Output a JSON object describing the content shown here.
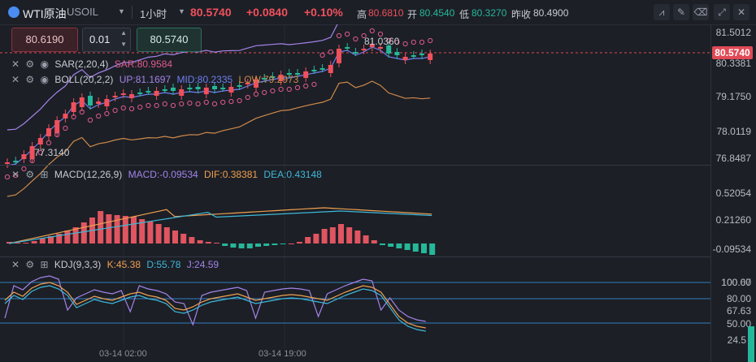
{
  "header": {
    "symbol_icon": "symbol-logo-icon",
    "symbol_name": "WTI原油",
    "symbol_code": "USOIL",
    "interval": "1小时",
    "price": "80.5740",
    "change": "+0.0840",
    "change_pct": "+0.10%",
    "high_label": "高",
    "high": "80.6810",
    "open_label": "开",
    "open": "80.4540",
    "low_label": "低",
    "low": "80.3270",
    "prev_close_label": "昨收",
    "prev_close": "80.4900",
    "colors": {
      "up": "#f0505c",
      "down": "#26b79a",
      "text": "#c9ccd3"
    }
  },
  "toolbar": {
    "icons": [
      "line-chart-icon",
      "pencil-icon",
      "delete-drawing-icon",
      "expand-icon",
      "close-icon"
    ]
  },
  "order": {
    "sell_price": "80.6190",
    "lot": "0.01",
    "buy_price": "80.5740"
  },
  "main_legend": {
    "sar_name": "SAR(2,20,4)",
    "sar_value": "SAR:80.9584",
    "boll_name": "BOLL(20,2,2)",
    "boll_up": "UP:81.1697",
    "boll_mid": "MID:80.2335",
    "boll_low": "LOW:79.2973"
  },
  "main_axis": {
    "labels": [
      "81.5012",
      "80.3381",
      "79.1750",
      "78.0119",
      "76.8487"
    ],
    "current_price": "80.5740",
    "high_marker": "81.0360",
    "low_marker": "77.3140"
  },
  "macd_legend": {
    "name": "MACD(12,26,9)",
    "macd": "MACD:-0.09534",
    "dif": "DIF:0.38381",
    "dea": "DEA:0.43148"
  },
  "macd_axis": {
    "labels": [
      "0.52054",
      "0.21260",
      "-0.09534"
    ]
  },
  "kdj_legend": {
    "name": "KDJ(9,3,3)",
    "k": "K:45.38",
    "d": "D:55.78",
    "j": "J:24.59"
  },
  "kdj_axis": {
    "labels": [
      "100.00",
      "100.67",
      "80.00",
      "67.63",
      "50.00",
      "24.5"
    ]
  },
  "time_axis": {
    "labels": [
      "03-14 02:00",
      "03-14 19:00"
    ]
  }
}
